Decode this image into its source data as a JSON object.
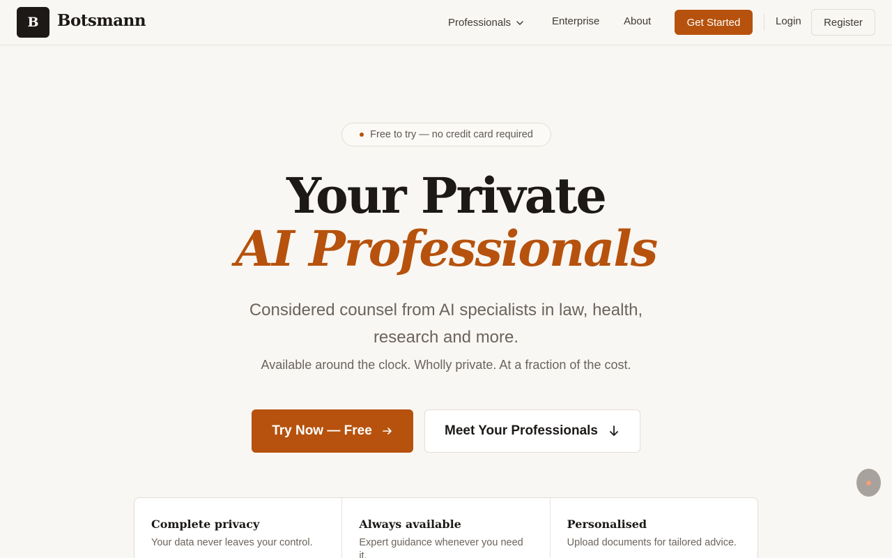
{
  "header": {
    "logo_letter": "B",
    "brand": "Botsmann",
    "nav": {
      "professionals": "Professionals",
      "enterprise": "Enterprise",
      "about": "About"
    },
    "get_started": "Get Started",
    "login": "Login",
    "register": "Register"
  },
  "hero": {
    "pill": "Free to try — no credit card required",
    "title_line1": "Your Private",
    "title_line2": "AI Professionals",
    "subtitle": "Considered counsel from AI specialists in law, health, research and more.",
    "tagline": "Available around the clock. Wholly private. At a fraction of the cost.",
    "cta_primary": "Try Now — Free",
    "cta_secondary": "Meet Your Professionals"
  },
  "features": [
    {
      "title": "Complete privacy",
      "desc": "Your data never leaves your control."
    },
    {
      "title": "Always available",
      "desc": "Expert guidance whenever you need it."
    },
    {
      "title": "Personalised",
      "desc": "Upload documents for tailored advice."
    }
  ],
  "colors": {
    "accent": "#b6520d",
    "background": "#f9f7f3",
    "ink": "#1c1917"
  }
}
